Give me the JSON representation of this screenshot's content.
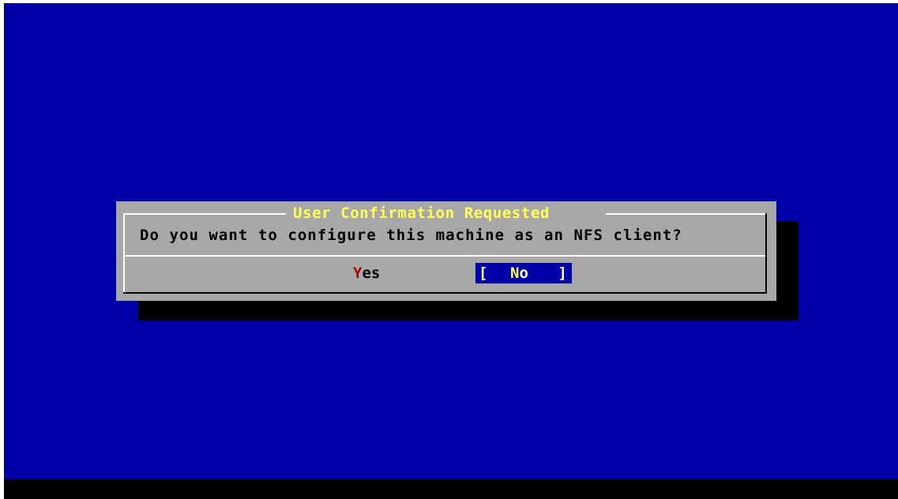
{
  "dialog": {
    "title": "User Confirmation Requested",
    "message": "Do you want to configure this machine as an NFS client?",
    "buttons": {
      "yes": {
        "hotkey": "Y",
        "rest": "es"
      },
      "no": {
        "bracket_open": "[",
        "hotkey": "N",
        "rest": "o",
        "bracket_close": "]"
      }
    }
  },
  "colors": {
    "desktop": "#0000a8",
    "dialog": "#a8a8a8",
    "title": "#ffff54",
    "hotkey_unselected": "#a80000",
    "selected_button_bg": "#0000a8",
    "bottom_bar": "#000000"
  }
}
